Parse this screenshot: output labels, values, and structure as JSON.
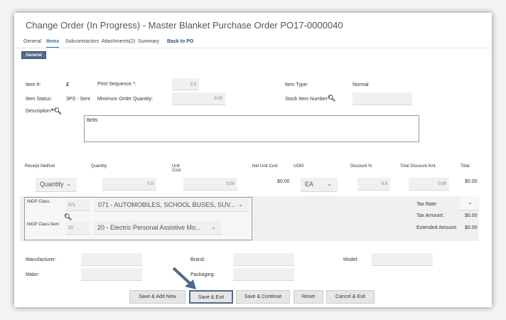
{
  "title": "Change Order (In Progress) - Master Blanket Purchase Order PO17-0000040",
  "tabs": [
    "General",
    "Items",
    "Subcontractors",
    "Attachments(2)",
    "Summary",
    "Back to PO"
  ],
  "subtab": "General",
  "fields": {
    "item_no_label": "Item #:",
    "item_no": "2",
    "print_seq_label": "Print Sequence",
    "print_seq": "2.0",
    "item_type_label": "Item Type:",
    "item_type": "Normal",
    "item_status_label": "Item Status:",
    "item_status": "3PS - Sent",
    "min_qty_label": "Minimum Order Quantity:",
    "min_qty": "0.00",
    "stock_label": "Stock Item Number:",
    "stock": "",
    "desc_label": "Description:",
    "desc": "Belts"
  },
  "grid": {
    "headers": [
      "Receipt Method",
      "Quantity",
      "Unit Cost",
      "Net Unit Cost",
      "UOM",
      "Discount %",
      "Total Discount Amt.",
      "Total"
    ],
    "receipt": "Quantity",
    "quantity": "0.0",
    "unit_cost": "0.00",
    "net_unit_cost": "$0.00",
    "uom": "EA",
    "discount": "0.0",
    "total_discount": "0.00",
    "total": "$0.00"
  },
  "nigp": {
    "class_label": "NIGP Class:",
    "class_code": "071",
    "class_value": "071 - AUTOMOBILES, SCHOOL BUSES, SUV...",
    "item_label": "NIGP Class Item:",
    "item_code": "20",
    "item_value": "20 - Electric Personal Assistive Mo..."
  },
  "tax": {
    "rate_label": "Tax Rate:",
    "amount_label": "Tax Amount:",
    "amount": "$0.00",
    "ext_label": "Extended Amount:",
    "ext": "$0.00"
  },
  "bottom": {
    "manufacturer": "Manufacturer:",
    "brand": "Brand:",
    "model": "Model:",
    "make": "Make:",
    "packaging": "Packaging:"
  },
  "buttons": [
    "Save & Add New",
    "Save & Exit",
    "Save & Continue",
    "Reset",
    "Cancel & Exit"
  ],
  "colors": {
    "accent": "#4f6b8a",
    "tab_active": "#2a6fa8"
  }
}
